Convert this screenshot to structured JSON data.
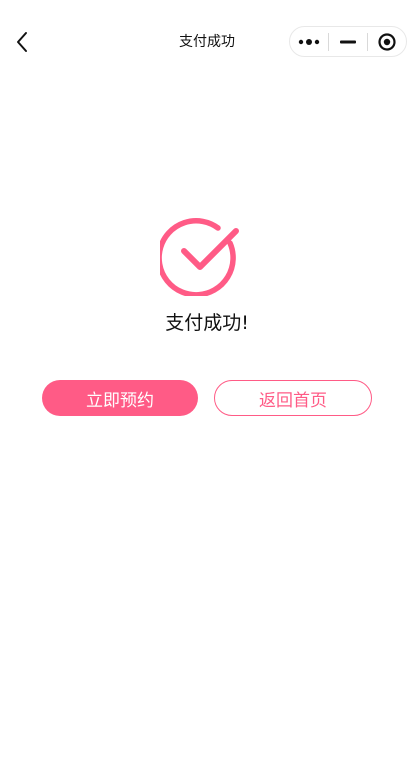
{
  "navbar": {
    "title": "支付成功",
    "back_icon": "chevron-left-icon",
    "capsule": {
      "more_icon": "more-dots-icon",
      "minimize_icon": "minimize-icon",
      "close_icon": "target-close-icon"
    }
  },
  "result": {
    "icon": "check-circle-icon",
    "message": "支付成功!"
  },
  "actions": {
    "book_now_label": "立即预约",
    "back_home_label": "返回首页"
  },
  "colors": {
    "accent": "#ff5b86",
    "text": "#111111",
    "background": "#ffffff"
  }
}
